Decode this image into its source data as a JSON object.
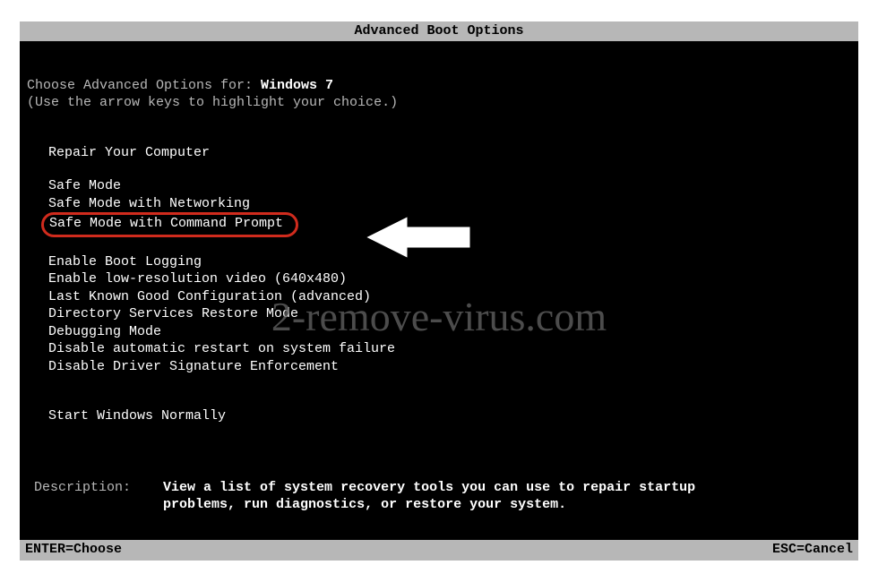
{
  "title": "Advanced Boot Options",
  "prompt_prefix": "Choose Advanced Options for: ",
  "prompt_os": "Windows 7",
  "hint": "(Use the arrow keys to highlight your choice.)",
  "menu": {
    "group1": [
      "Repair Your Computer"
    ],
    "group2": [
      "Safe Mode",
      "Safe Mode with Networking"
    ],
    "highlighted": "Safe Mode with Command Prompt",
    "group3": [
      "Enable Boot Logging",
      "Enable low-resolution video (640x480)",
      "Last Known Good Configuration (advanced)",
      "Directory Services Restore Mode",
      "Debugging Mode",
      "Disable automatic restart on system failure",
      "Disable Driver Signature Enforcement"
    ],
    "group4": [
      "Start Windows Normally"
    ]
  },
  "description": {
    "label": "Description:    ",
    "text": "View a list of system recovery tools you can use to repair startup problems, run diagnostics, or restore your system."
  },
  "footer": {
    "left": "ENTER=Choose",
    "right": "ESC=Cancel"
  },
  "watermark": "2-remove-virus.com"
}
